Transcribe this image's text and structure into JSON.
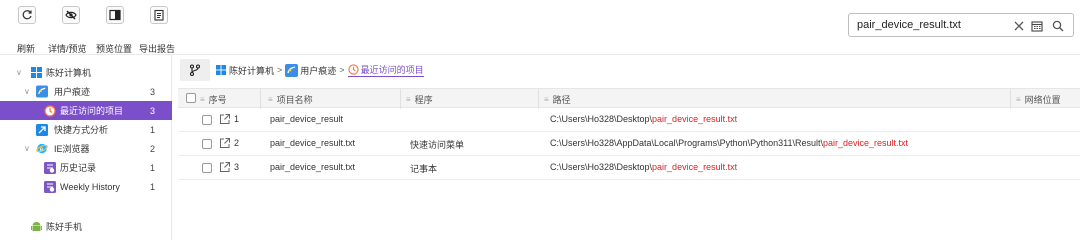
{
  "toolbar": {
    "refresh_label": "刷新",
    "details_label": "详情/预览",
    "preview_pos_label": "预览位置",
    "export_label": "导出报告"
  },
  "search": {
    "value": "pair_device_result.txt"
  },
  "sidebar": {
    "items": [
      {
        "label": "陈好计算机",
        "count": ""
      },
      {
        "label": "用户痕迹",
        "count": "3"
      },
      {
        "label": "最近访问的项目",
        "count": "3"
      },
      {
        "label": "快捷方式分析",
        "count": "1"
      },
      {
        "label": "IE浏览器",
        "count": "2"
      },
      {
        "label": "历史记录",
        "count": "1"
      },
      {
        "label": "Weekly History",
        "count": "1"
      },
      {
        "label": "陈好手机",
        "count": ""
      }
    ]
  },
  "breadcrumb": {
    "items": [
      "陈好计算机",
      "用户痕迹",
      "最近访问的项目"
    ],
    "separator": ">"
  },
  "table": {
    "headers": [
      "序号",
      "项目名称",
      "程序",
      "路径",
      "网络位置"
    ],
    "rows": [
      {
        "index": "1",
        "name": "pair_device_result",
        "program": "",
        "path_prefix": "C:\\Users\\Ho328\\Desktop\\",
        "path_match": "pair_device_result.txt"
      },
      {
        "index": "2",
        "name": "pair_device_result.txt",
        "program": "快速访问菜单",
        "path_prefix": "C:\\Users\\Ho328\\AppData\\Local\\Programs\\Python\\Python311\\Result\\",
        "path_match": "pair_device_result.txt"
      },
      {
        "index": "3",
        "name": "pair_device_result.txt",
        "program": "记事本",
        "path_prefix": "C:\\Users\\Ho328\\Desktop\\",
        "path_match": "pair_device_result.txt"
      }
    ]
  },
  "colors": {
    "accent": "#7b4fc9",
    "highlight": "#e02020"
  }
}
